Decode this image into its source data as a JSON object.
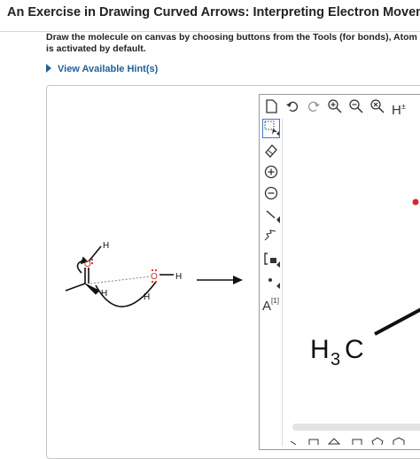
{
  "page": {
    "title": "An Exercise in Drawing Curved Arrows: Interpreting Electron Movement",
    "instructions_line1": "Draw the molecule on canvas by choosing buttons from the Tools (for bonds), Atom",
    "instructions_line2": "is activated by default.",
    "hint_link": "View Available Hint(s)"
  },
  "scheme": {
    "atoms": {
      "h_top": "H",
      "o_left": "O",
      "h_left_lower": "H",
      "h_middle": "H",
      "o_right": "O",
      "h_right": "H"
    }
  },
  "editor": {
    "toolbar_top": [
      "new-document-icon",
      "undo-icon",
      "redo-icon",
      "zoom-in-icon",
      "zoom-out-icon",
      "clear-canvas-icon",
      "explicit-hydrogens-icon"
    ],
    "toolbar_left": [
      "selection-tool-icon",
      "eraser-icon",
      "positive-charge-icon",
      "negative-charge-icon",
      "single-bond-icon",
      "chain-tool-icon",
      "bracket-tool-icon",
      "radical-icon",
      "atom-label-tool-icon"
    ],
    "hydrogen_label": "H",
    "atom_tool_label": "A",
    "atom_tool_superscript": "[1]",
    "canvas_group": {
      "carbon": "C",
      "hydrogen": "H",
      "subscript": "3"
    },
    "accent_red": "#d42a2a"
  }
}
